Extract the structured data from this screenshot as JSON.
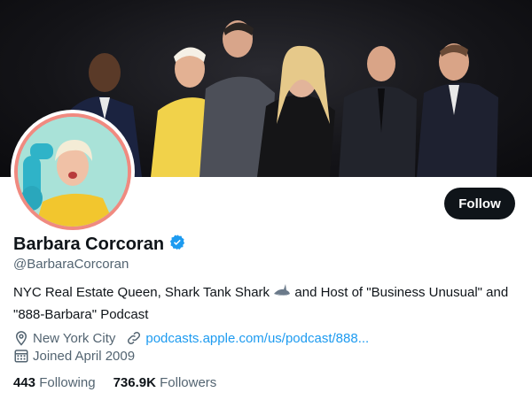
{
  "profile": {
    "name": "Barbara Corcoran",
    "handle": "@BarbaraCorcoran",
    "verified": true,
    "bio_part1": "NYC Real Estate Queen, Shark Tank Shark",
    "bio_part2": "and Host of \"Business Unusual\" and \"888-Barbara\" Podcast",
    "location": "New York City",
    "website": "podcasts.apple.com/us/podcast/888...",
    "joined": "Joined April 2009",
    "following_count": "443",
    "following_label": "Following",
    "followers_count": "736.9K",
    "followers_label": "Followers"
  },
  "actions": {
    "follow_label": "Follow"
  },
  "icons": {
    "verified": "verified-badge-icon",
    "location": "location-pin-icon",
    "link": "link-icon",
    "calendar": "calendar-icon",
    "bio_emoji": "shark-icon"
  },
  "colors": {
    "accent": "#1d9bf0",
    "text": "#0f1419",
    "secondary": "#536471",
    "avatar_border": "#f08a80",
    "button_bg": "#0f1419"
  }
}
